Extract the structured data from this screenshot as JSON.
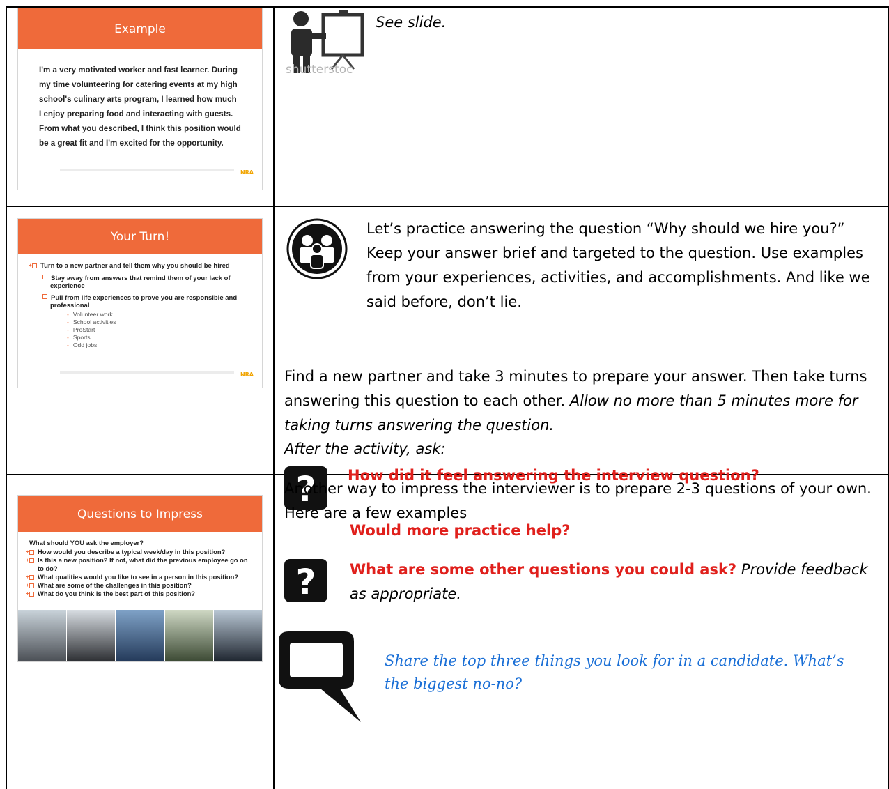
{
  "row1": {
    "slide": {
      "title": "Example",
      "body": "I'm a very motivated worker and fast learner. During my time volunteering for catering events at my high school's culinary arts program, I learned how much I enjoy preparing food and interacting with guests. From what you described, I think this position would be a great fit and I'm excited for the opportunity."
    },
    "note": "See slide.",
    "icon_watermark": "shutterstoc"
  },
  "row2": {
    "slide": {
      "title": "Your Turn!",
      "bullet1": "Turn to a new partner and tell them why you should be hired",
      "sub1": "Stay away from answers that remind them of your lack of experience",
      "sub2": "Pull from life experiences to prove you are responsible and professional",
      "items": [
        "Volunteer work",
        "School activities",
        "ProStart",
        "Sports",
        "Odd jobs"
      ]
    },
    "para1": "Let’s practice answering the question “Why should we hire you?” Keep your answer brief and targeted to the question. Use examples from your experiences, activities, and accomplishments. And like we said before, don’t lie.",
    "para2_plain": "Find a new partner and take 3 minutes to prepare your answer. Then take turns answering this question to each other.",
    "para2_italic": "Allow no more than 5 minutes more for taking turns answering the question.",
    "ask_label": "After the activity, ask:",
    "question1": "How did it feel answering the interview question?",
    "question2": "Would more practice help?"
  },
  "row3": {
    "slide": {
      "title": "Questions to Impress",
      "lead": "What should YOU ask the employer?",
      "items": [
        "How would you describe a typical week/day in this position?",
        "Is this a new position? If not, what did the previous employee go on to do?",
        "What qualities would you like to see in a person in this position?",
        "What are some of the challenges in this position?",
        "What do you think is the best part of this position?"
      ]
    },
    "para1": "Another way to impress the interviewer is to prepare 2-3 questions of your own. Here are a few examples",
    "question_red": "What are some other questions you could ask?",
    "question_italic": "Provide feedback as appropriate.",
    "share": "Share the top three things you look for in a candidate. What’s the biggest no-no?"
  },
  "colors": {
    "banner": "#ef6a3a",
    "question_red": "#e0201c",
    "share_blue": "#1a6fd6"
  },
  "icons": [
    "presenter-icon",
    "group-discussion-icon",
    "question-icon",
    "speech-bubble-icon"
  ]
}
